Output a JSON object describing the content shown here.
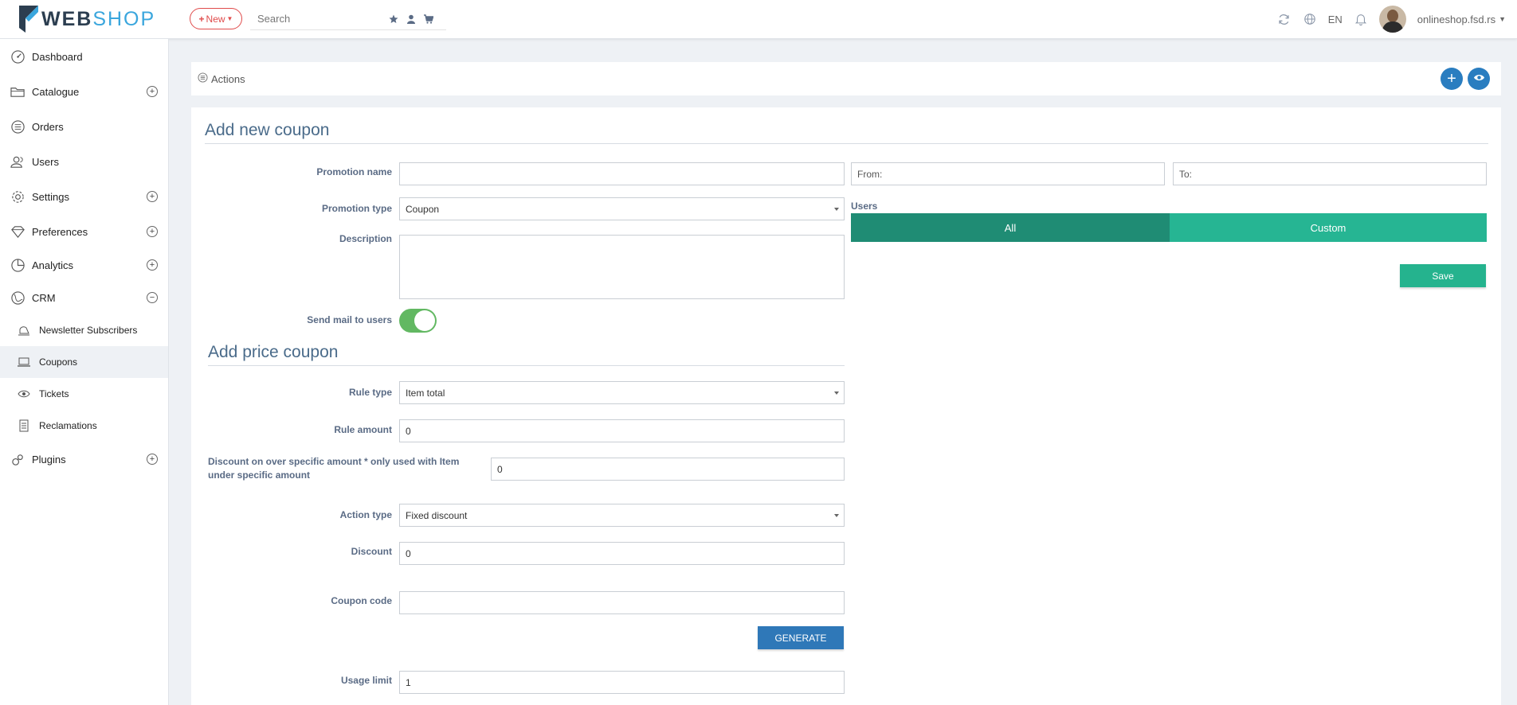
{
  "header": {
    "logo_web": "WEB",
    "logo_shop": "SHOP",
    "new_label": "New",
    "search_placeholder": "Search",
    "language": "EN",
    "site": "onlineshop.fsd.rs"
  },
  "sidebar": {
    "items": [
      {
        "label": "Dashboard",
        "icon": "gauge-icon"
      },
      {
        "label": "Catalogue",
        "icon": "folder-icon"
      },
      {
        "label": "Orders",
        "icon": "list-icon"
      },
      {
        "label": "Users",
        "icon": "users-icon"
      },
      {
        "label": "Settings",
        "icon": "gear-icon"
      },
      {
        "label": "Preferences",
        "icon": "diamond-icon"
      },
      {
        "label": "Analytics",
        "icon": "pie-chart-icon"
      },
      {
        "label": "CRM",
        "icon": "globe-icon"
      }
    ],
    "crm_sub": [
      {
        "label": "Newsletter Subscribers"
      },
      {
        "label": "Coupons"
      },
      {
        "label": "Tickets"
      },
      {
        "label": "Reclamations"
      }
    ],
    "plugins": "Plugins"
  },
  "actions": {
    "label": "Actions"
  },
  "form": {
    "title": "Add new coupon",
    "promotion_name_label": "Promotion name",
    "promotion_name_value": "",
    "from_placeholder": "From:",
    "to_placeholder": "To:",
    "promotion_type_label": "Promotion type",
    "promotion_type_value": "Coupon",
    "description_label": "Description",
    "description_value": "",
    "send_mail_label": "Send mail to users",
    "send_mail_on": true,
    "users_label": "Users",
    "users_all": "All",
    "users_custom": "Custom",
    "save_label": "Save"
  },
  "price_coupon": {
    "title": "Add price coupon",
    "rule_type_label": "Rule type",
    "rule_type_value": "Item total",
    "rule_amount_label": "Rule amount",
    "rule_amount_value": "0",
    "discount_over_label": "Discount on over specific amount * only used with Item under specific amount",
    "discount_over_value": "0",
    "action_type_label": "Action type",
    "action_type_value": "Fixed discount",
    "discount_label": "Discount",
    "discount_value": "0",
    "coupon_code_label": "Coupon code",
    "coupon_code_value": "",
    "generate_label": "GENERATE",
    "usage_limit_label": "Usage limit",
    "usage_limit_value": "1"
  },
  "colors": {
    "users_all_bg": "#1f8c74",
    "users_custom_bg": "#26b593",
    "save_bg": "#25b38e",
    "generate_bg": "#2f78b8",
    "toggle_on": "#62b862",
    "new_btn": "#e04b4b"
  }
}
